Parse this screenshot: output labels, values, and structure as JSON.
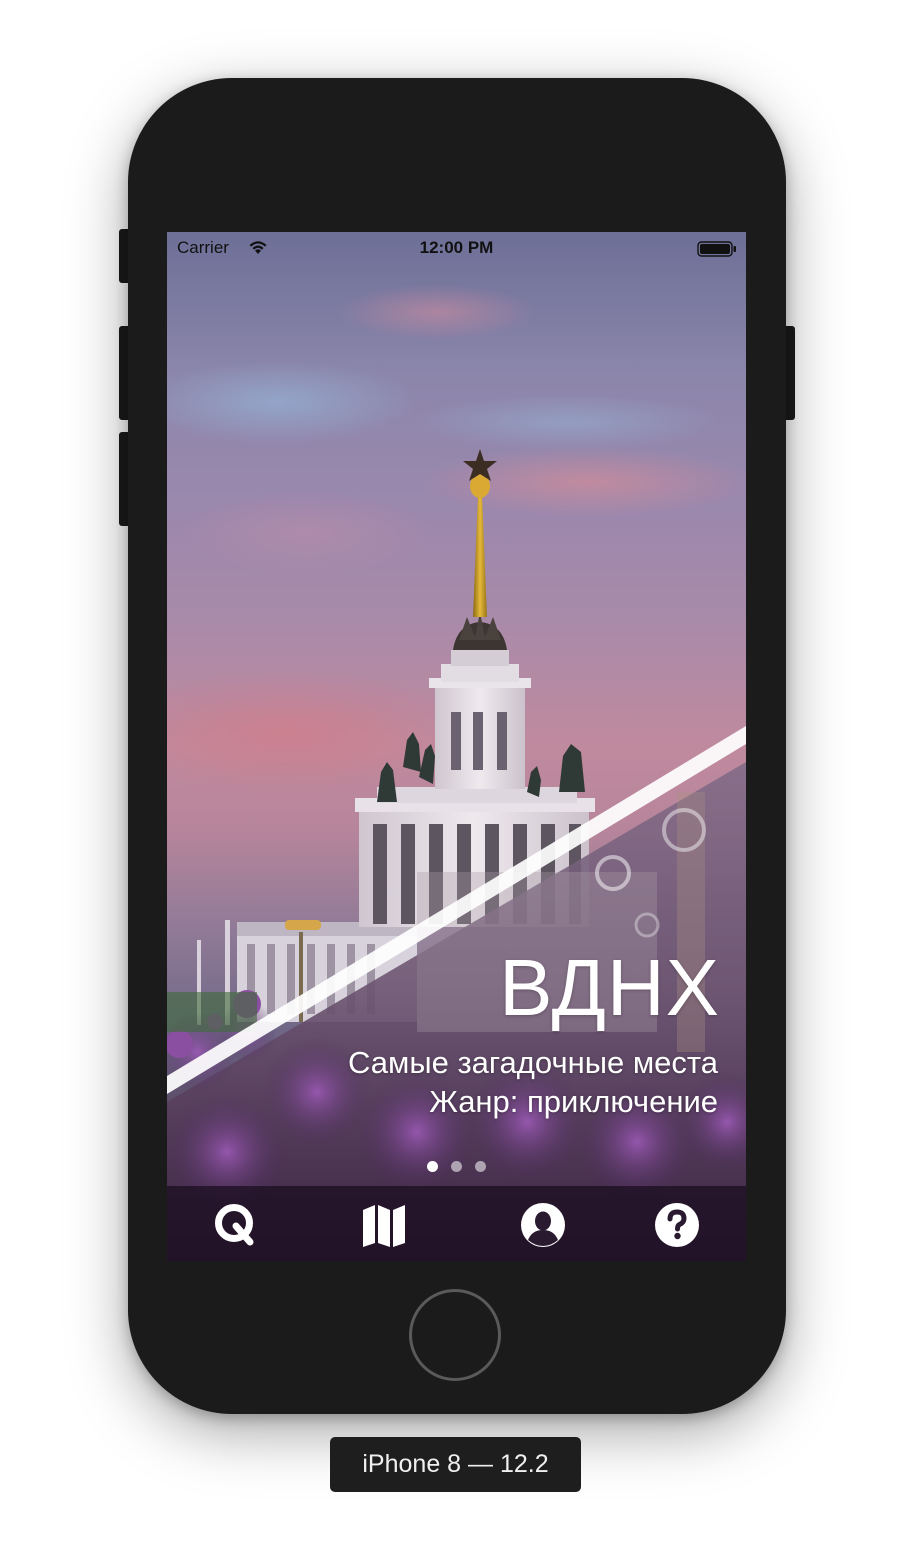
{
  "status_bar": {
    "carrier": "Carrier",
    "time": "12:00 PM",
    "wifi_icon": "wifi-icon",
    "battery_icon": "battery-full-icon"
  },
  "slide": {
    "title": "ВДНХ",
    "subtitle_line1": "Самые загадочные места",
    "subtitle_line2": "Жанр: приключение",
    "page_count": 3,
    "current_page": 1
  },
  "tab_bar": {
    "items": [
      {
        "icon": "quest-q-icon"
      },
      {
        "icon": "map-icon"
      },
      {
        "icon": "profile-icon"
      },
      {
        "icon": "help-icon"
      }
    ]
  },
  "device_label": "iPhone 8 — 12.2",
  "colors": {
    "phone_body": "#1b1b1b",
    "text_on_image": "#ffffff",
    "tab_bar_bg": "#190c1e"
  }
}
